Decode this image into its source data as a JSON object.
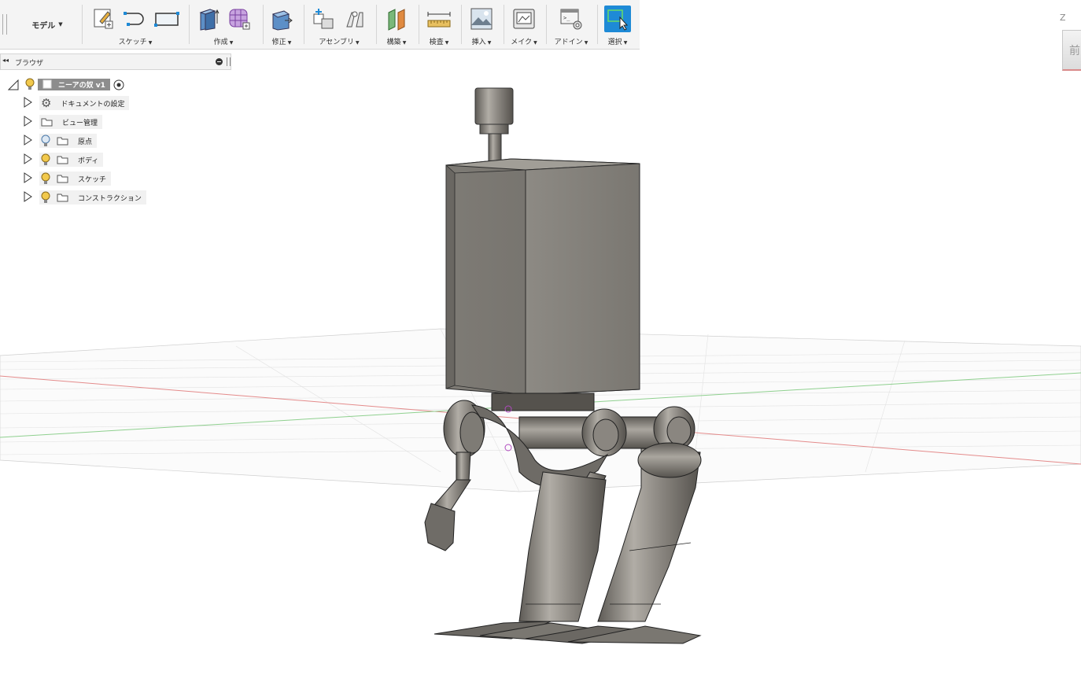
{
  "toolbar": {
    "workspace": "モデル",
    "groups": [
      {
        "label": "スケッチ"
      },
      {
        "label": "作成"
      },
      {
        "label": "修正"
      },
      {
        "label": "アセンブリ"
      },
      {
        "label": "構築"
      },
      {
        "label": "検査"
      },
      {
        "label": "挿入"
      },
      {
        "label": "メイク"
      },
      {
        "label": "アドイン"
      },
      {
        "label": "選択"
      }
    ]
  },
  "browser": {
    "title": "ブラウザ",
    "root": "ニーアの奴 v1",
    "items": [
      {
        "label": "ドキュメントの設定",
        "icon": "gear-icon"
      },
      {
        "label": "ビュー管理",
        "icon": "folder-icon"
      },
      {
        "label": "原点",
        "icon": "folder-icon"
      },
      {
        "label": "ボディ",
        "icon": "folder-icon"
      },
      {
        "label": "スケッチ",
        "icon": "folder-icon"
      },
      {
        "label": "コンストラクション",
        "icon": "folder-icon"
      }
    ]
  },
  "viewcube": {
    "axis": "Z",
    "face": "前"
  },
  "colors": {
    "accent": "#1e8ad6",
    "model": "#7f7c76",
    "grid": "#d6d6d6",
    "x_axis": "#e07070",
    "y_axis": "#7acc7a"
  }
}
